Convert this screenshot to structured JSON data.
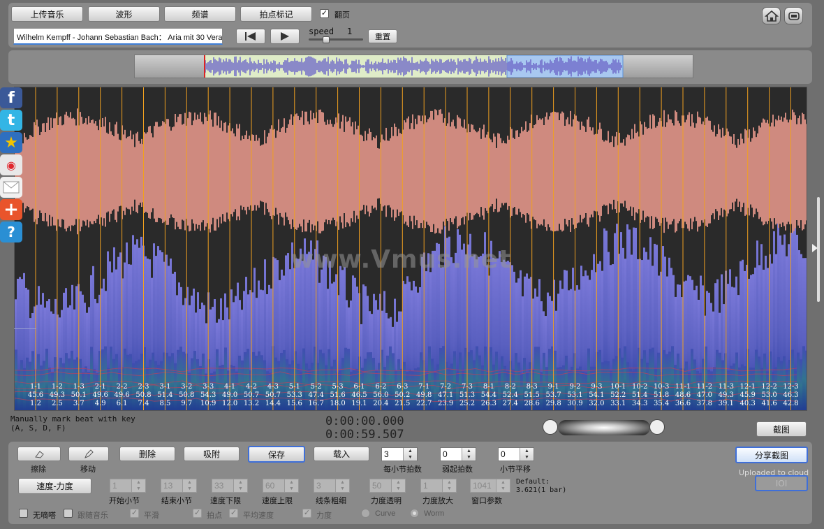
{
  "toolbar": {
    "upload": "上传音乐",
    "waveform": "波形",
    "spectrum": "频谱",
    "beat_mark": "拍点标记",
    "flip_label": "翻页",
    "flip_checked": true,
    "track_title": "Wilhelm Kempff - Johann Sebastian Bach：  Aria mit 30 Vera",
    "speed_label": "speed",
    "speed_value": "1",
    "reset": "重置"
  },
  "watermark": "www.Vmus.net",
  "beats": [
    {
      "label": "1-1",
      "tempo": "45.6",
      "time": "1.2"
    },
    {
      "label": "1-2",
      "tempo": "49.3",
      "time": "2.5"
    },
    {
      "label": "1-3",
      "tempo": "50.1",
      "time": "3.7"
    },
    {
      "label": "2-1",
      "tempo": "49.6",
      "time": "4.9"
    },
    {
      "label": "2-2",
      "tempo": "49.6",
      "time": "6.1"
    },
    {
      "label": "2-3",
      "tempo": "50.8",
      "time": "7.4"
    },
    {
      "label": "3-1",
      "tempo": "51.4",
      "time": "8.5"
    },
    {
      "label": "3-2",
      "tempo": "50.8",
      "time": "9.7"
    },
    {
      "label": "3-3",
      "tempo": "54.3",
      "time": "10.9"
    },
    {
      "label": "4-1",
      "tempo": "49.0",
      "time": "12.0"
    },
    {
      "label": "4-2",
      "tempo": "50.7",
      "time": "13.2"
    },
    {
      "label": "4-3",
      "tempo": "50.7",
      "time": "14.4"
    },
    {
      "label": "5-1",
      "tempo": "53.3",
      "time": "15.6"
    },
    {
      "label": "5-2",
      "tempo": "47.4",
      "time": "16.7"
    },
    {
      "label": "5-3",
      "tempo": "51.6",
      "time": "18.0"
    },
    {
      "label": "6-1",
      "tempo": "46.5",
      "time": "19.1"
    },
    {
      "label": "6-2",
      "tempo": "56.0",
      "time": "20.4"
    },
    {
      "label": "6-3",
      "tempo": "50.2",
      "time": "21.5"
    },
    {
      "label": "7-1",
      "tempo": "49.8",
      "time": "22.7"
    },
    {
      "label": "7-2",
      "tempo": "47.1",
      "time": "23.9"
    },
    {
      "label": "7-3",
      "tempo": "51.3",
      "time": "25.2"
    },
    {
      "label": "8-1",
      "tempo": "54.4",
      "time": "26.3"
    },
    {
      "label": "8-2",
      "tempo": "52.4",
      "time": "27.4"
    },
    {
      "label": "8-3",
      "tempo": "51.5",
      "time": "28.6"
    },
    {
      "label": "9-1",
      "tempo": "53.7",
      "time": "29.8"
    },
    {
      "label": "9-2",
      "tempo": "53.1",
      "time": "30.9"
    },
    {
      "label": "9-3",
      "tempo": "54.1",
      "time": "32.0"
    },
    {
      "label": "10-1",
      "tempo": "52.2",
      "time": "33.1"
    },
    {
      "label": "10-2",
      "tempo": "51.4",
      "time": "34.3"
    },
    {
      "label": "10-3",
      "tempo": "51.8",
      "time": "35.4"
    },
    {
      "label": "11-1",
      "tempo": "48.6",
      "time": "36.6"
    },
    {
      "label": "11-2",
      "tempo": "47.0",
      "time": "37.8"
    },
    {
      "label": "11-3",
      "tempo": "49.3",
      "time": "39.1"
    },
    {
      "label": "12-1",
      "tempo": "45.9",
      "time": "40.3"
    },
    {
      "label": "12-2",
      "tempo": "53.0",
      "time": "41.6"
    },
    {
      "label": "12-3",
      "tempo": "46.3",
      "time": "42.8"
    }
  ],
  "status": {
    "hint_line1": "Manually mark beat with key",
    "hint_line2": "(A, S, D, F)",
    "time_current": "0:00:00.000",
    "time_total": "0:00:59.507",
    "screenshot": "截图"
  },
  "controls": {
    "erase": "擦除",
    "move": "移动",
    "delete": "删除",
    "snap": "吸附",
    "save": "保存",
    "load": "载入",
    "beats_per_bar_label": "每小节拍数",
    "beats_per_bar": "3",
    "pickup_label": "弱起拍数",
    "pickup": "0",
    "bar_shift_label": "小节平移",
    "bar_shift": "0",
    "share_screenshot": "分享截图",
    "uploaded": "Uploaded to cloud",
    "ioi": "IOI",
    "tempo_dynamics": "速度-力度",
    "start_bar_label": "开始小节",
    "start_bar": "1",
    "end_bar_label": "结束小节",
    "end_bar": "13",
    "tempo_low_label": "速度下限",
    "tempo_low": "33",
    "tempo_high_label": "速度上限",
    "tempo_high": "60",
    "line_width_label": "线条粗细",
    "line_width": "3",
    "dyn_opacity_label": "力度透明",
    "dyn_opacity": "50",
    "dyn_scale_label": "力度放大",
    "dyn_scale": "1",
    "window_label": "窗口参数",
    "window_value": "1041",
    "default_line1": "Default:",
    "default_line2": "3.621(1 bar)",
    "no_tick": "无嘀嗒",
    "follow_music": "跟随音乐",
    "smooth": "平滑",
    "beat_point": "拍点",
    "avg_tempo": "平均速度",
    "dynamics": "力度",
    "curve": "Curve",
    "worm": "Worm"
  },
  "colors": {
    "waveform": "#cf8a7f",
    "spectrum": "#6d68c8",
    "beatline": "#f0a020",
    "selection": "#a8c8f0",
    "accent": "#3f6fd8"
  }
}
